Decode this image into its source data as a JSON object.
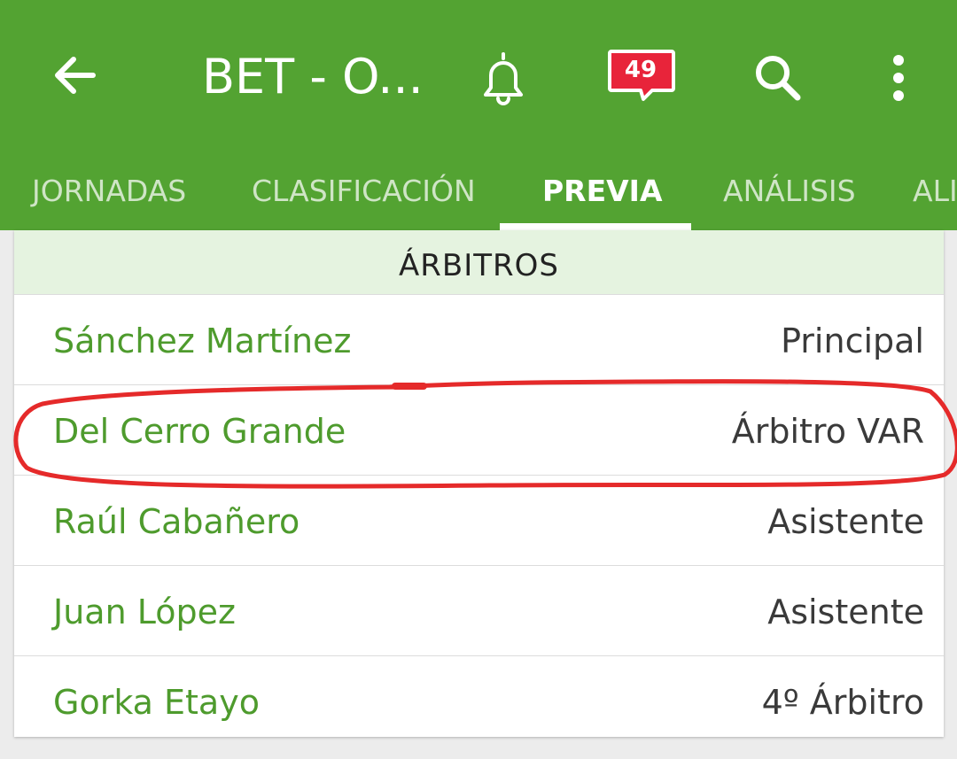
{
  "header": {
    "title": "BET  -  O...",
    "notification_count": "49",
    "bar_color": "#53a332"
  },
  "icons": {
    "back": "arrow-left-icon",
    "notifications": "bell-icon",
    "comments": "chat-bubble-icon",
    "search": "search-icon",
    "more": "more-vert-icon"
  },
  "tabs": [
    {
      "label": "JORNADAS",
      "active": false
    },
    {
      "label": "CLASIFICACIÓN",
      "active": false
    },
    {
      "label": "PREVIA",
      "active": true
    },
    {
      "label": "ANÁLISIS",
      "active": false
    },
    {
      "label": "ALI",
      "active": false
    }
  ],
  "referees": {
    "section_title": "ÁRBITROS",
    "rows": [
      {
        "name": "Sánchez Martínez",
        "role": "Principal"
      },
      {
        "name": "Del Cerro Grande",
        "role": "Árbitro VAR",
        "circled": true
      },
      {
        "name": "Raúl Cabañero",
        "role": "Asistente"
      },
      {
        "name": "Juan López",
        "role": "Asistente"
      },
      {
        "name": "Gorka Etayo",
        "role": "4º Árbitro"
      }
    ]
  },
  "colors": {
    "accent_green": "#53a332",
    "name_green": "#4e9b2d",
    "badge_red": "#e8243a",
    "annotation_red": "#e52a2a"
  }
}
